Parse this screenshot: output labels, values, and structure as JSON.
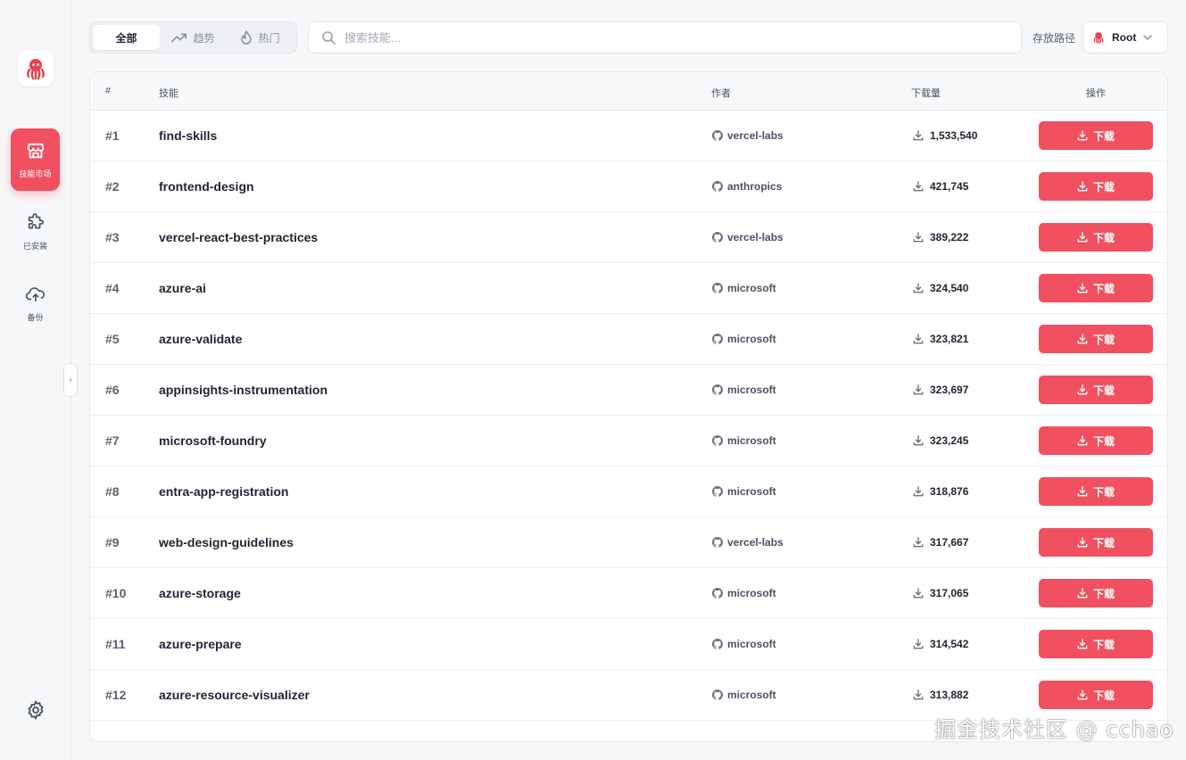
{
  "sidebar": {
    "items": [
      {
        "label": "技能市场",
        "icon": "store-icon",
        "active": true
      },
      {
        "label": "已安装",
        "icon": "puzzle-icon",
        "active": false
      },
      {
        "label": "备份",
        "icon": "cloud-upload-icon",
        "active": false
      }
    ],
    "settings_icon": "gear-icon",
    "collapse_glyph": "›"
  },
  "tabs": [
    {
      "label": "全部",
      "icon": "",
      "active": true
    },
    {
      "label": "趋势",
      "icon": "trending-icon",
      "active": false
    },
    {
      "label": "热门",
      "icon": "flame-icon",
      "active": false
    }
  ],
  "search": {
    "placeholder": "搜索技能...",
    "value": ""
  },
  "path": {
    "label": "存放路径",
    "selected": "Root"
  },
  "table": {
    "headers": {
      "rank": "#",
      "skill": "技能",
      "author": "作者",
      "downloads": "下载量",
      "action": "操作"
    },
    "button_label": "下载",
    "rows": [
      {
        "rank": "#1",
        "name": "find-skills",
        "author": "vercel-labs",
        "downloads": "1,533,540"
      },
      {
        "rank": "#2",
        "name": "frontend-design",
        "author": "anthropics",
        "downloads": "421,745"
      },
      {
        "rank": "#3",
        "name": "vercel-react-best-practices",
        "author": "vercel-labs",
        "downloads": "389,222"
      },
      {
        "rank": "#4",
        "name": "azure-ai",
        "author": "microsoft",
        "downloads": "324,540"
      },
      {
        "rank": "#5",
        "name": "azure-validate",
        "author": "microsoft",
        "downloads": "323,821"
      },
      {
        "rank": "#6",
        "name": "appinsights-instrumentation",
        "author": "microsoft",
        "downloads": "323,697"
      },
      {
        "rank": "#7",
        "name": "microsoft-foundry",
        "author": "microsoft",
        "downloads": "323,245"
      },
      {
        "rank": "#8",
        "name": "entra-app-registration",
        "author": "microsoft",
        "downloads": "318,876"
      },
      {
        "rank": "#9",
        "name": "web-design-guidelines",
        "author": "vercel-labs",
        "downloads": "317,667"
      },
      {
        "rank": "#10",
        "name": "azure-storage",
        "author": "microsoft",
        "downloads": "317,065"
      },
      {
        "rank": "#11",
        "name": "azure-prepare",
        "author": "microsoft",
        "downloads": "314,542"
      },
      {
        "rank": "#12",
        "name": "azure-resource-visualizer",
        "author": "microsoft",
        "downloads": "313,882"
      }
    ]
  },
  "watermark": "掘金技术社区 @ cchao",
  "colors": {
    "accent": "#f0505f",
    "background": "#f6f7f9",
    "text": "#1f2430"
  }
}
